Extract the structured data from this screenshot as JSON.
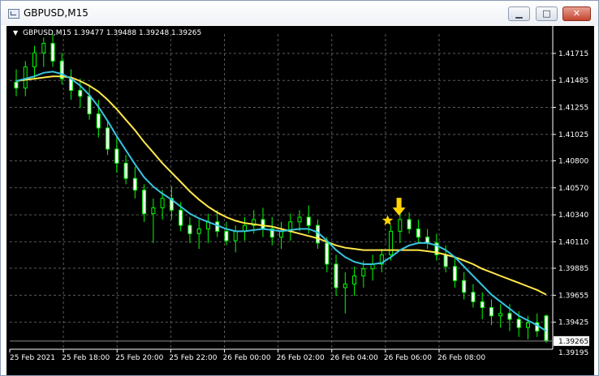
{
  "window": {
    "title": "GBPUSD,M15",
    "icon": "chart-window-icon"
  },
  "controls": {
    "minimize": "▁",
    "maximize": "□",
    "close": "✕"
  },
  "header": {
    "symbol": "GBPUSD,M15",
    "ohlc": "1.39477 1.39488 1.39248 1.39265"
  },
  "chart_data": {
    "type": "candlestick",
    "symbol": "GBPUSD",
    "timeframe": "M15",
    "ylim": [
      1.39195,
      1.4188
    ],
    "price_ticks": [
      "1.41715",
      "1.41485",
      "1.41255",
      "1.41025",
      "1.40800",
      "1.40570",
      "1.40340",
      "1.40110",
      "1.39885",
      "1.39655",
      "1.39425"
    ],
    "current_price": "1.39265",
    "lowest_visible": "1.39195",
    "time_ticks": [
      "25 Feb 2021",
      "25 Feb 18:00",
      "25 Feb 20:00",
      "25 Feb 22:00",
      "26 Feb 00:00",
      "26 Feb 02:00",
      "26 Feb 04:00",
      "26 Feb 06:00",
      "26 Feb 08:00"
    ],
    "colors": {
      "background": "#000000",
      "bull": "#000000",
      "bear": "#ffffff",
      "candle_outline": "#00ff00",
      "fast_ma": "#37c4e0",
      "slow_ma": "#ffe84a",
      "grid": "#5a5a5a",
      "marker": "#ffd400"
    },
    "candles": [
      [
        1.4147,
        1.4158,
        1.4135,
        1.4142
      ],
      [
        1.4142,
        1.4165,
        1.4135,
        1.416
      ],
      [
        1.416,
        1.4178,
        1.415,
        1.4172
      ],
      [
        1.4172,
        1.4185,
        1.416,
        1.418
      ],
      [
        1.418,
        1.4188,
        1.416,
        1.4165
      ],
      [
        1.4165,
        1.4172,
        1.4145,
        1.415
      ],
      [
        1.415,
        1.4158,
        1.4132,
        1.414
      ],
      [
        1.414,
        1.415,
        1.4125,
        1.4135
      ],
      [
        1.4135,
        1.4145,
        1.4115,
        1.412
      ],
      [
        1.412,
        1.4132,
        1.41,
        1.4108
      ],
      [
        1.4108,
        1.4115,
        1.4085,
        1.409
      ],
      [
        1.409,
        1.41,
        1.407,
        1.4078
      ],
      [
        1.4078,
        1.4085,
        1.406,
        1.4065
      ],
      [
        1.4065,
        1.4075,
        1.4048,
        1.4055
      ],
      [
        1.4055,
        1.406,
        1.4028,
        1.4035
      ],
      [
        1.4035,
        1.4048,
        1.401,
        1.404
      ],
      [
        1.404,
        1.4055,
        1.403,
        1.4048
      ],
      [
        1.4048,
        1.4058,
        1.403,
        1.4038
      ],
      [
        1.4038,
        1.4045,
        1.402,
        1.4025
      ],
      [
        1.4025,
        1.4032,
        1.401,
        1.4018
      ],
      [
        1.4018,
        1.403,
        1.4005,
        1.4022
      ],
      [
        1.4022,
        1.4035,
        1.401,
        1.4028
      ],
      [
        1.4028,
        1.4038,
        1.4015,
        1.402
      ],
      [
        1.402,
        1.4028,
        1.4008,
        1.4012
      ],
      [
        1.4012,
        1.4025,
        1.4002,
        1.402
      ],
      [
        1.402,
        1.4032,
        1.4012,
        1.4025
      ],
      [
        1.4025,
        1.4038,
        1.4018,
        1.403
      ],
      [
        1.403,
        1.404,
        1.4015,
        1.4022
      ],
      [
        1.4022,
        1.4032,
        1.4008,
        1.4015
      ],
      [
        1.4015,
        1.4028,
        1.4005,
        1.402
      ],
      [
        1.402,
        1.4035,
        1.4012,
        1.4028
      ],
      [
        1.4028,
        1.4038,
        1.402,
        1.4032
      ],
      [
        1.4032,
        1.4042,
        1.4018,
        1.4025
      ],
      [
        1.4025,
        1.403,
        1.4005,
        1.401
      ],
      [
        1.401,
        1.4015,
        1.3985,
        1.3992
      ],
      [
        1.3992,
        1.4,
        1.3965,
        1.3972
      ],
      [
        1.3972,
        1.3985,
        1.395,
        1.3975
      ],
      [
        1.3975,
        1.399,
        1.3965,
        1.3982
      ],
      [
        1.3982,
        1.3995,
        1.3972,
        1.3988
      ],
      [
        1.3988,
        1.4,
        1.3978,
        1.3992
      ],
      [
        1.3992,
        1.4005,
        1.3985,
        1.4
      ],
      [
        1.4,
        1.4025,
        1.3995,
        1.402
      ],
      [
        1.402,
        1.404,
        1.401,
        1.403
      ],
      [
        1.403,
        1.4036,
        1.4018,
        1.4022
      ],
      [
        1.4022,
        1.403,
        1.401,
        1.4015
      ],
      [
        1.4015,
        1.4022,
        1.4005,
        1.401
      ],
      [
        1.401,
        1.4018,
        1.3995,
        1.4
      ],
      [
        1.4,
        1.4008,
        1.3985,
        1.399
      ],
      [
        1.399,
        1.3998,
        1.3972,
        1.3978
      ],
      [
        1.3978,
        1.3985,
        1.3962,
        1.3968
      ],
      [
        1.3968,
        1.3975,
        1.3955,
        1.396
      ],
      [
        1.396,
        1.3968,
        1.3945,
        1.3955
      ],
      [
        1.3955,
        1.3962,
        1.394,
        1.3948
      ],
      [
        1.3948,
        1.3958,
        1.3938,
        1.395
      ],
      [
        1.395,
        1.3958,
        1.3935,
        1.3945
      ],
      [
        1.3945,
        1.3952,
        1.393,
        1.3938
      ],
      [
        1.3938,
        1.3948,
        1.3928,
        1.3942
      ],
      [
        1.3942,
        1.395,
        1.393,
        1.3935
      ],
      [
        1.3948,
        1.3949,
        1.3925,
        1.3927
      ]
    ],
    "fast_ma": [
      1.4148,
      1.415,
      1.4152,
      1.4155,
      1.4156,
      1.4154,
      1.415,
      1.4144,
      1.4136,
      1.4126,
      1.4114,
      1.4101,
      1.4089,
      1.4077,
      1.4066,
      1.4058,
      1.4052,
      1.4047,
      1.4041,
      1.4035,
      1.4031,
      1.4028,
      1.4025,
      1.4022,
      1.402,
      1.402,
      1.4021,
      1.4022,
      1.4021,
      1.402,
      1.4021,
      1.4022,
      1.4022,
      1.4019,
      1.4012,
      1.4004,
      1.3998,
      1.3994,
      1.3992,
      1.3992,
      1.3993,
      1.3998,
      1.4004,
      1.4008,
      1.401,
      1.401,
      1.4008,
      1.4004,
      1.3998,
      1.399,
      1.3982,
      1.3974,
      1.3966,
      1.396,
      1.3954,
      1.3948,
      1.3944,
      1.394,
      1.3935
    ],
    "slow_ma": [
      1.4148,
      1.4149,
      1.415,
      1.4151,
      1.4152,
      1.4152,
      1.4151,
      1.4148,
      1.4144,
      1.4139,
      1.4132,
      1.4124,
      1.4115,
      1.4106,
      1.4096,
      1.4087,
      1.4078,
      1.407,
      1.4062,
      1.4054,
      1.4047,
      1.4041,
      1.4036,
      1.4032,
      1.4029,
      1.4027,
      1.4026,
      1.4025,
      1.4024,
      1.4022,
      1.402,
      1.4018,
      1.4016,
      1.4014,
      1.4011,
      1.4008,
      1.4006,
      1.4005,
      1.4004,
      1.4004,
      1.4004,
      1.4004,
      1.4004,
      1.4004,
      1.4004,
      1.4003,
      1.4002,
      1.4,
      1.3998,
      1.3995,
      1.3992,
      1.3988,
      1.3985,
      1.3982,
      1.3979,
      1.3976,
      1.3973,
      1.397,
      1.3966
    ],
    "signal_candle_index": 41
  }
}
